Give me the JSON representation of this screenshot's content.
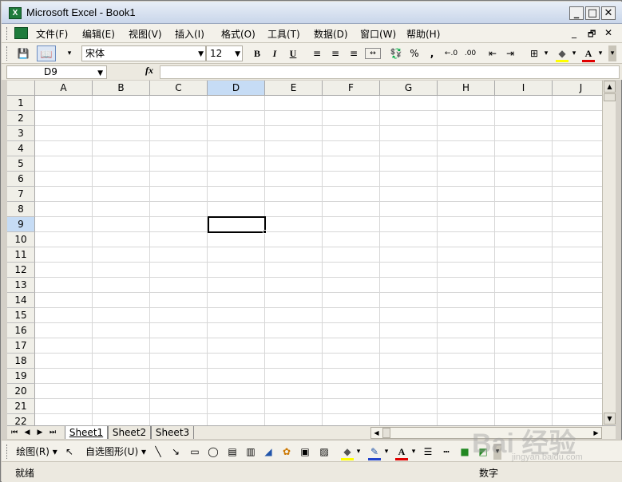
{
  "window": {
    "title": "Microsoft Excel - Book1",
    "app_icon_text": "X",
    "minimize_glyph": "_",
    "maximize_glyph": "□",
    "close_glyph": "✕"
  },
  "menubar": {
    "items": [
      {
        "label": "文件(F)"
      },
      {
        "label": "编辑(E)"
      },
      {
        "label": "视图(V)"
      },
      {
        "label": "插入(I)"
      },
      {
        "label": "格式(O)"
      },
      {
        "label": "工具(T)"
      },
      {
        "label": "数据(D)"
      },
      {
        "label": "窗口(W)"
      },
      {
        "label": "帮助(H)"
      }
    ],
    "doc_minimize": "_",
    "doc_restore": "🗗",
    "doc_close": "✕"
  },
  "toolbar": {
    "save_icon": "💾",
    "research_icon": "📖",
    "font_name": "宋体",
    "font_size": "12",
    "bold": "B",
    "italic": "I",
    "underline": "U",
    "percent": "%",
    "comma": ",",
    "fill_icon": "◆",
    "font_color_letter": "A",
    "accent_red": "#e00000",
    "accent_yellow": "#ffff00"
  },
  "formulabar": {
    "name_box": "D9",
    "fx_label": "fx",
    "formula": ""
  },
  "sheet": {
    "columns": [
      "A",
      "B",
      "C",
      "D",
      "E",
      "F",
      "G",
      "H",
      "I",
      "J"
    ],
    "rows": [
      "1",
      "2",
      "3",
      "4",
      "5",
      "6",
      "7",
      "8",
      "9",
      "10",
      "11",
      "12",
      "13",
      "14",
      "15",
      "16",
      "17",
      "18",
      "19",
      "20",
      "21",
      "22"
    ],
    "active_column": "D",
    "active_row": "9",
    "header_active_color": "#c6dcf5"
  },
  "tabs": {
    "sheets": [
      "Sheet1",
      "Sheet2",
      "Sheet3"
    ],
    "active": "Sheet1"
  },
  "drawbar": {
    "draw_label": "绘图(R)",
    "autoshapes_label": "自选图形(U)"
  },
  "statusbar": {
    "ready": "就绪",
    "mode": "数字"
  },
  "watermark": {
    "text": "Bai 经验",
    "url": "jingyan.baidu.com"
  }
}
